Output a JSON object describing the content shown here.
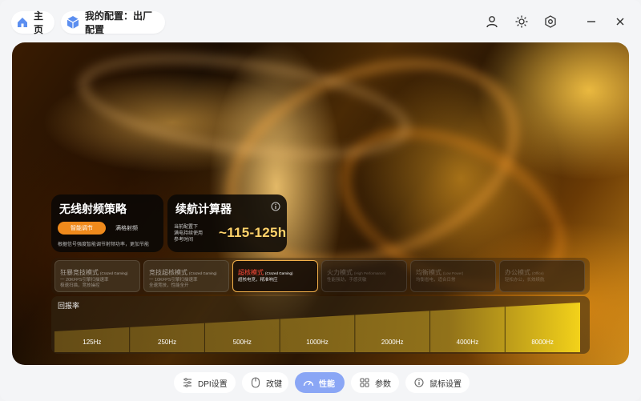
{
  "topbar": {
    "home_label": "主页",
    "config_label": "我的配置：出厂配置"
  },
  "rf_card": {
    "title": "无线射频策略",
    "smart_button": "智能调节",
    "full_button": "满格射频",
    "description": "根据信号强度智能调节射频功率，更加节能"
  },
  "battery_card": {
    "title": "续航计算器",
    "desc_line1": "当前配置下",
    "desc_line2": "满电持续使用",
    "desc_line3": "参考时间",
    "value": "~115-125h"
  },
  "modes": [
    {
      "name": "狂暴竞技模式",
      "en": "(Crazed Gaming)",
      "desc1": "一 20KFPS引擎扫描速率",
      "desc2": "极速扫描，竞技操控",
      "state": "normal"
    },
    {
      "name": "竞技超核模式",
      "en": "(Crazed Gaming)",
      "desc1": "一 10KFPS引擎扫描速率",
      "desc2": "全速竞技，性能全开",
      "state": "normal"
    },
    {
      "name": "超核模式",
      "en": "(Crazed Gaming)",
      "desc1": "超核电竞，精准响应",
      "desc2": "",
      "state": "active"
    },
    {
      "name": "火力模式",
      "en": "(High Performance)",
      "desc1": "性能强劲，手感灵敏",
      "desc2": "",
      "state": "dim"
    },
    {
      "name": "均衡模式",
      "en": "(Low Power)",
      "desc1": "均衡省电，适合日常",
      "desc2": "",
      "state": "dim"
    },
    {
      "name": "办公模式",
      "en": "(Office)",
      "desc1": "轻松办公，长效续航",
      "desc2": "",
      "state": "dim"
    }
  ],
  "report_rate": {
    "label": "回报率",
    "options": [
      "125Hz",
      "250Hz",
      "500Hz",
      "1000Hz",
      "2000Hz",
      "4000Hz",
      "8000Hz"
    ],
    "selected": "8000Hz"
  },
  "bottom_nav": [
    {
      "label": "DPI设置",
      "icon": "sliders-icon"
    },
    {
      "label": "改键",
      "icon": "mouse-icon"
    },
    {
      "label": "性能",
      "icon": "speedometer-icon",
      "active": true
    },
    {
      "label": "参数",
      "icon": "grid-icon"
    },
    {
      "label": "鼠标设置",
      "icon": "info-icon"
    }
  ],
  "colors": {
    "accent_orange": "#f08a1c",
    "active_mode_border": "#f3b04a",
    "active_mode_text": "#ff4a3a",
    "nav_active": "#8aa6f5",
    "battery_value": "#ffd36a"
  }
}
